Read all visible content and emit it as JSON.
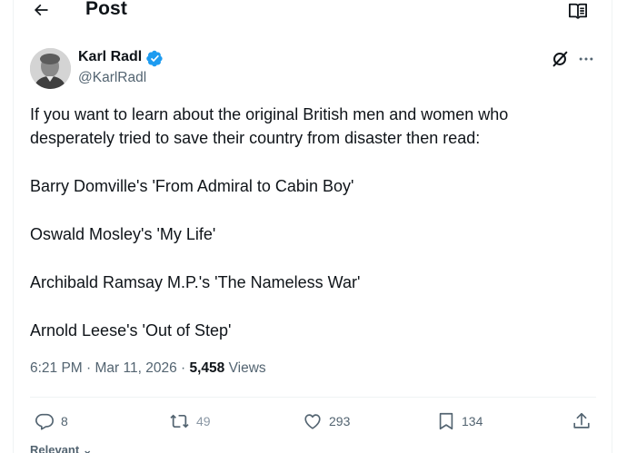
{
  "header": {
    "title": "Post"
  },
  "author": {
    "name": "Karl Radl",
    "handle": "@KarlRadl"
  },
  "tweet": {
    "line1": "If you want to learn about the original British men and women who",
    "line2": "desperately tried to save their country from disaster then read:",
    "book1": "Barry Domville's 'From Admiral to Cabin Boy'",
    "book2": "Oswald Mosley's 'My Life'",
    "book3": "Archibald Ramsay M.P.'s 'The Nameless War'",
    "book4": "Arnold Leese's 'Out of Step'"
  },
  "meta": {
    "time": "6:21 PM",
    "separator": " · ",
    "date": "Mar 11, 2026",
    "separator2": " · ",
    "views_count": "5,458",
    "views_label": " Views"
  },
  "actions": {
    "replies": "8",
    "reposts": "49",
    "likes": "293",
    "bookmarks": "134"
  },
  "sort": {
    "label": "Relevant ⌄"
  },
  "colors": {
    "text": "#0f1419",
    "secondary": "#536471",
    "verified": "#1d9bf0",
    "divider": "#eff3f4"
  },
  "icons": {
    "back": "arrow-left-icon",
    "reader": "reader-mode-icon",
    "verified": "verified-badge-icon",
    "grok": "grok-icon",
    "more": "more-icon",
    "reply": "reply-icon",
    "repost": "repost-icon",
    "like": "heart-icon",
    "bookmark": "bookmark-icon",
    "share": "share-icon"
  }
}
